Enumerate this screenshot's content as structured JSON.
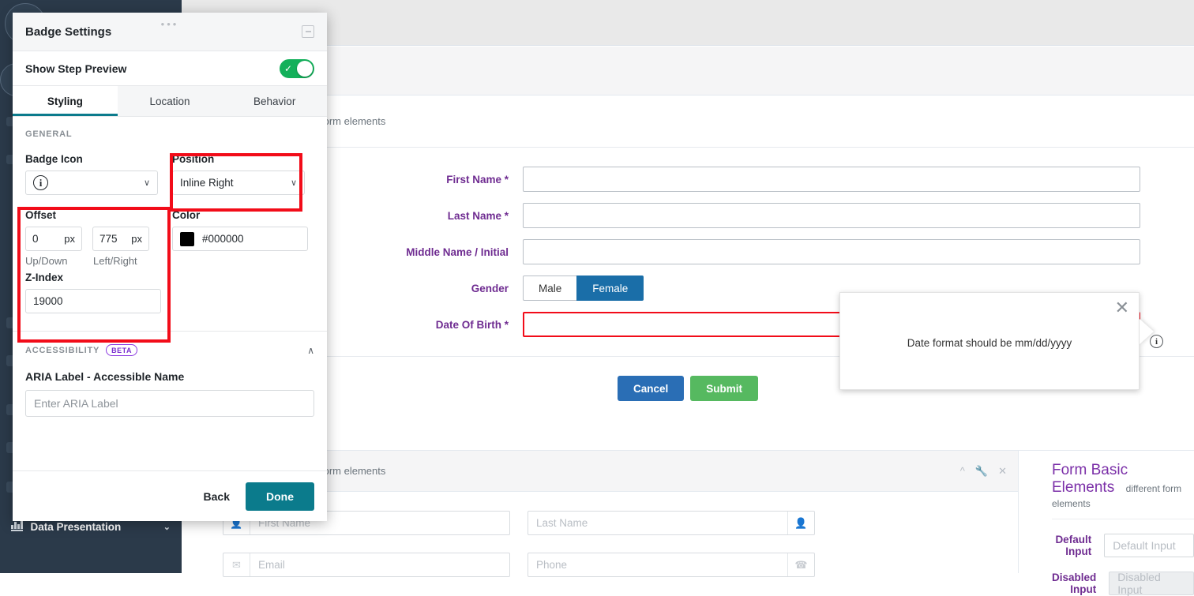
{
  "sidebar": {
    "items": [
      {
        "label": "Data Presentation",
        "icon": "bar-chart-icon",
        "chevron": "⌄"
      }
    ]
  },
  "panel": {
    "title": "Badge Settings",
    "drag_handle": "•••",
    "minimize_icon": "minimize-icon",
    "preview": {
      "label": "Show Step Preview",
      "enabled": true,
      "check": "✓"
    },
    "tabs": [
      {
        "label": "Styling",
        "active": true
      },
      {
        "label": "Location",
        "active": false
      },
      {
        "label": "Behavior",
        "active": false
      }
    ],
    "general": {
      "section_title": "GENERAL",
      "badge_icon": {
        "label": "Badge Icon",
        "value_icon": "info-circle-icon",
        "glyph": "i",
        "chevron": "∨"
      },
      "position": {
        "label": "Position",
        "value": "Inline Right",
        "chevron": "∨"
      },
      "offset": {
        "label": "Offset",
        "up_down": {
          "value": "0",
          "unit": "px",
          "hint": "Up/Down"
        },
        "left_right": {
          "value": "775",
          "unit": "px",
          "hint": "Left/Right"
        }
      },
      "color": {
        "label": "Color",
        "value": "#000000",
        "swatch": "#000000"
      },
      "z_index": {
        "label": "Z-Index",
        "value": "19000"
      }
    },
    "accessibility": {
      "section_title": "ACCESSIBILITY",
      "badge": "BETA",
      "collapse_chevron": "∧",
      "aria_label": "ARIA Label - Accessible Name",
      "aria_value": "",
      "aria_placeholder": "Enter ARIA Label"
    },
    "footer": {
      "back": "Back",
      "done": "Done"
    }
  },
  "tooltip": {
    "text": "Date format should be mm/dd/yyyy",
    "close_icon": "✕",
    "badge_glyph": "i"
  },
  "main_card": {
    "subtitle": "rent form elements",
    "fields": [
      {
        "label": "First Name *",
        "type": "text",
        "value": ""
      },
      {
        "label": "Last Name *",
        "type": "text",
        "value": ""
      },
      {
        "label": "Middle Name / Initial",
        "type": "text",
        "value": ""
      },
      {
        "label": "Gender",
        "type": "segmented",
        "options": [
          "Male",
          "Female"
        ],
        "selected": "Female"
      },
      {
        "label": "Date Of Birth *",
        "type": "text",
        "value": "",
        "error": true
      }
    ],
    "actions": {
      "cancel": "Cancel",
      "submit": "Submit"
    }
  },
  "bottom_left_card": {
    "subtitle": "rent form elements",
    "head_icons": [
      "chevron-up-icon",
      "wrench-icon",
      "close-icon"
    ],
    "inputs": [
      {
        "placeholder": "First Name",
        "icon": "user-icon",
        "icon_side": "left"
      },
      {
        "placeholder": "Last Name",
        "icon": "user-icon",
        "icon_side": "right"
      },
      {
        "placeholder": "Email",
        "icon": "mail-icon",
        "icon_side": "left"
      },
      {
        "placeholder": "Phone",
        "icon": "phone-icon",
        "icon_side": "right"
      }
    ]
  },
  "bottom_right_card": {
    "title": "Form Basic Elements",
    "subtitle": "different form elements",
    "rows": [
      {
        "label": "Default Input",
        "placeholder": "Default Input",
        "disabled": false
      },
      {
        "label": "Disabled Input",
        "placeholder": "Disabled Input",
        "disabled": true
      }
    ]
  },
  "colors": {
    "sidebar": "#2b3a4a",
    "accent_teal": "#0b7b8c",
    "toggle_on": "#13b05a",
    "label_purple": "#6f2c91",
    "annotation_red": "#f20c19",
    "submit_green": "#56b960",
    "cancel_blue": "#2a6eb5",
    "selected_blue": "#1a6ea8"
  }
}
